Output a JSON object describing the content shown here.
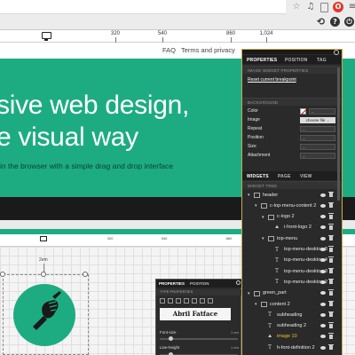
{
  "browser": {
    "icons": [
      "star-icon",
      "music-icon",
      "document-icon",
      "opera-icon",
      "menu-icon"
    ],
    "toolbar_icons": [
      "history-icon",
      "help-icon",
      "power-icon"
    ]
  },
  "ruler": {
    "ticks": [
      {
        "label": "320",
        "pos": 130
      },
      {
        "label": "540",
        "pos": 183
      },
      {
        "label": "860",
        "pos": 260
      },
      {
        "label": "1,024",
        "pos": 300
      }
    ]
  },
  "nav": {
    "faq": "FAQ",
    "terms": "Terms and privacy"
  },
  "hero": {
    "line_1": "sive web design,",
    "line_2": "e visual way",
    "subtitle": "in the browser with a simple drag and drop interface",
    "color": "#1dac82"
  },
  "lower_editor": {
    "ruler_labels": [
      "320",
      "540",
      "860"
    ],
    "dimension_label": "2em",
    "mini_panel": {
      "tab_properties": "PROPERTIES",
      "tab_position": "POSITION",
      "section": "TYPE PROPERTIES",
      "font_name": "Abril Fatface",
      "font_size_label": "Font-size",
      "font_size_unit": "1 em",
      "line_height_label": "Line-height",
      "line_height_unit": "1 em"
    }
  },
  "panel": {
    "accent": "#c9a94e",
    "tabs_top": [
      "PROPERTIES",
      "POSITION",
      "TAG"
    ],
    "image_section": "IMAGE WIDGET PROPERTIES",
    "reset_link": "Reset current breakpoint",
    "background_section": "BACKGROUND",
    "rows": [
      {
        "label": "Color",
        "value": "--"
      },
      {
        "label": "Image",
        "value": "choose file ..."
      },
      {
        "label": "Repeat",
        "value": "--"
      },
      {
        "label": "Position",
        "value": "--"
      },
      {
        "label": "Size",
        "value": "--"
      },
      {
        "label": "Attachment",
        "value": "--"
      }
    ],
    "tabs_bottom": [
      "WIDGETS",
      "PAGE",
      "VIEW"
    ],
    "tree_section": "WIDGET TREE",
    "tree": [
      {
        "label": "header",
        "icon": "box",
        "indent": 0,
        "arrow": true
      },
      {
        "label": "c-top-menu-content 2",
        "icon": "box",
        "indent": 1,
        "arrow": true
      },
      {
        "label": "c-logo 2",
        "icon": "box",
        "indent": 2,
        "arrow": true
      },
      {
        "label": "i-front-logo 2",
        "icon": "image",
        "indent": 3,
        "arrow": false
      },
      {
        "label": "top-menu",
        "icon": "box",
        "indent": 2,
        "arrow": true
      },
      {
        "label": "top-menu-desktop 8",
        "icon": "text",
        "indent": 3,
        "arrow": false
      },
      {
        "label": "top-menu-desktop 4",
        "icon": "text",
        "indent": 3,
        "arrow": false
      },
      {
        "label": "top-menu-desktop 3",
        "icon": "text",
        "indent": 3,
        "arrow": false
      },
      {
        "label": "top-menu-desktop 2",
        "icon": "text",
        "indent": 3,
        "arrow": false
      },
      {
        "label": "green_part",
        "icon": "box",
        "indent": 0,
        "arrow": true
      },
      {
        "label": "content 2",
        "icon": "box",
        "indent": 1,
        "arrow": true
      },
      {
        "label": "subheading",
        "icon": "text",
        "indent": 2,
        "arrow": false
      },
      {
        "label": "subheading 2",
        "icon": "text",
        "indent": 2,
        "arrow": false
      },
      {
        "label": "image 10",
        "icon": "image",
        "indent": 2,
        "arrow": false,
        "selected": true
      },
      {
        "label": "h-font-definition 2",
        "icon": "text",
        "indent": 2,
        "arrow": false
      }
    ]
  }
}
